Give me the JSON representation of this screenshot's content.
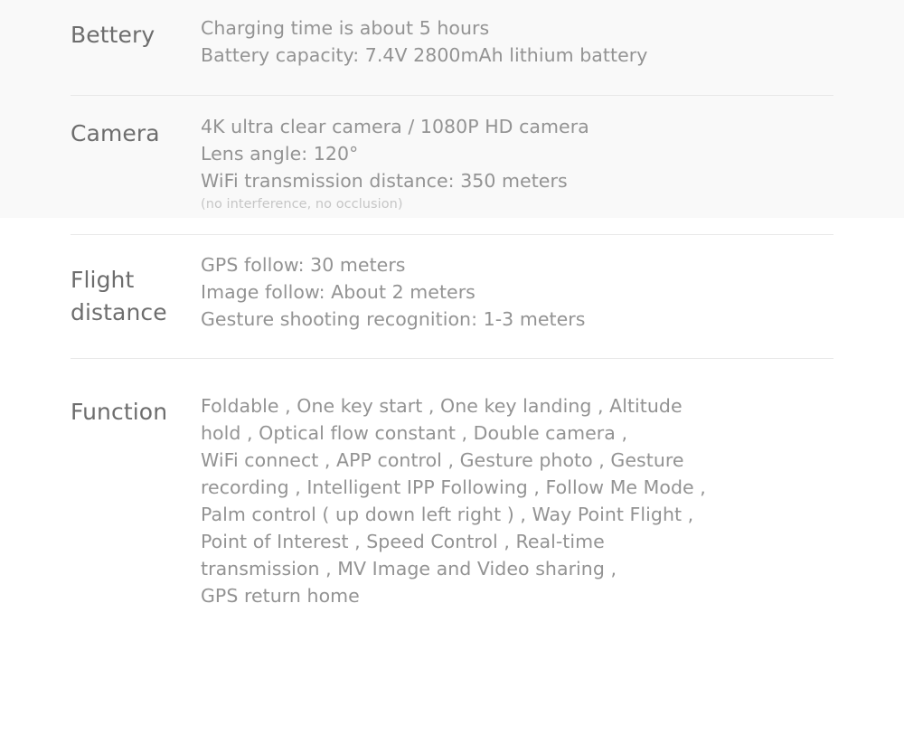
{
  "colors": {
    "label_text": "#6d6d6d",
    "value_text": "#939393",
    "note_text": "#c6c6c6",
    "divider": "#e8e8e8",
    "background": "#ffffff",
    "top_wash": "#f9f9f9"
  },
  "spec_table": {
    "rows": [
      {
        "label": "Bettery",
        "lines": [
          "Charging time is about 5 hours",
          "Battery capacity: 7.4V 2800mAh lithium battery"
        ],
        "note": ""
      },
      {
        "label": "Camera",
        "lines": [
          "4K ultra clear camera / 1080P HD camera",
          "Lens angle: 120°",
          "WiFi transmission distance: 350 meters"
        ],
        "note": "(no interference, no occlusion)"
      },
      {
        "label_line_1": "Flight",
        "label_line_2": "distance",
        "label": "Flight distance",
        "lines": [
          "GPS follow: 30 meters",
          "Image follow: About 2 meters",
          "Gesture shooting recognition: 1-3 meters"
        ],
        "note": ""
      },
      {
        "label": "Function",
        "lines": [
          "Foldable , One key start , One key landing , Altitude",
          "hold , Optical flow constant , Double camera ,",
          "WiFi connect , APP control , Gesture photo , Gesture",
          "recording , Intelligent IPP Following , Follow Me Mode ,",
          "Palm control ( up down left right ) , Way Point Flight ,",
          "Point of Interest , Speed Control , Real-time",
          "transmission , MV Image and Video sharing ,",
          "GPS return home"
        ],
        "note": ""
      }
    ]
  }
}
